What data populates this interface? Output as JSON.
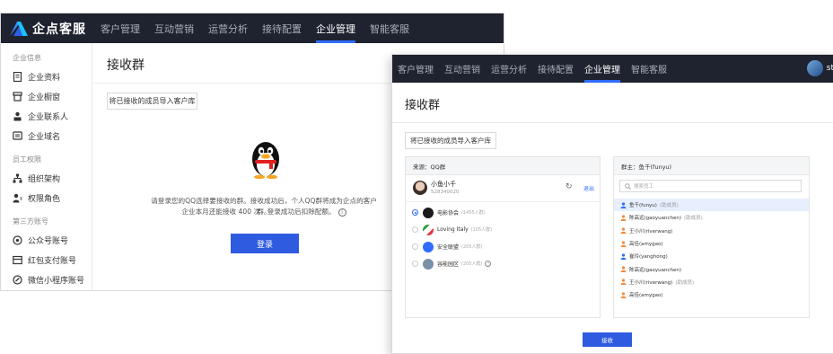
{
  "brand": {
    "name": "企点客服"
  },
  "nav": {
    "items": [
      "客户管理",
      "互动营销",
      "运营分析",
      "接待配置",
      "企业管理",
      "智能客服"
    ],
    "active_index": 4
  },
  "sidebar": {
    "groups": [
      {
        "title": "企业信息",
        "items": [
          {
            "label": "企业资料",
            "icon": "document-icon"
          },
          {
            "label": "企业橱窗",
            "icon": "store-icon"
          },
          {
            "label": "企业联系人",
            "icon": "contacts-icon"
          },
          {
            "label": "企业域名",
            "icon": "domain-icon"
          }
        ]
      },
      {
        "title": "员工权限",
        "items": [
          {
            "label": "组织架构",
            "icon": "org-chart-icon"
          },
          {
            "label": "权限角色",
            "icon": "role-icon"
          }
        ]
      },
      {
        "title": "第三方账号",
        "items": [
          {
            "label": "公众号账号",
            "icon": "official-account-icon"
          },
          {
            "label": "红包支付账号",
            "icon": "wallet-icon"
          },
          {
            "label": "微信小程序账号",
            "icon": "mini-program-icon"
          }
        ]
      }
    ]
  },
  "page": {
    "title": "接收群",
    "import_button": "将已接收的成员导入客户库"
  },
  "login_view": {
    "desc_line1": "请登录您的QQ选择要接收的群。接收成功后，个人QQ群将成为企点的客户群。",
    "desc_line2": "企业本月还能接收 400 次，登录成功后扣除配额。",
    "login_button": "登录"
  },
  "window2": {
    "user_name": "st",
    "source_panel": {
      "header": "来源：QQ群",
      "account_name": "小鱼小千",
      "account_id": "528340020",
      "refresh_icon": "refresh-icon",
      "logout_label": "退出",
      "groups": [
        {
          "name": "电影协会",
          "count": "(1455人群)",
          "checked": true,
          "color": "#1a1a1a"
        },
        {
          "name": "Loving Italy",
          "count": "(105人群)",
          "checked": false,
          "color": "#e03a3a"
        },
        {
          "name": "安全联盟",
          "count": "(205人群)",
          "checked": false,
          "color": "#2f6bff"
        },
        {
          "name": "容能园区",
          "count": "(205人群)",
          "checked": false,
          "color": "#7a8fa8",
          "info": true
        }
      ]
    },
    "member_panel": {
      "header": "群主：鱼千(funyu)",
      "search_placeholder": "搜索员工",
      "members": [
        {
          "name": "鱼千(funyu)",
          "tag": "(助成员)",
          "role": "owner",
          "selected": true
        },
        {
          "name": "陈高远(gaoyuanchen)",
          "tag": "(助成员)",
          "role": "member",
          "selected": false
        },
        {
          "name": "王小川(riverwang)",
          "tag": "",
          "role": "member",
          "selected": false
        },
        {
          "name": "高佳(amygao)",
          "tag": "",
          "role": "member",
          "selected": false
        },
        {
          "name": "崔玲(yanghong)",
          "tag": "",
          "role": "owner",
          "selected": false
        },
        {
          "name": "陈高远(gaoyuanchen)",
          "tag": "",
          "role": "member",
          "selected": false
        },
        {
          "name": "王小川(riverwang)",
          "tag": "(助成员)",
          "role": "member",
          "selected": false
        },
        {
          "name": "高佳(amygao)",
          "tag": "",
          "role": "member",
          "selected": false
        }
      ]
    },
    "accept_button": "接收"
  },
  "colors": {
    "topbar": "#1f2330",
    "accent": "#2f5be0",
    "owner_icon": "#2f6bff",
    "member_icon": "#f0883a"
  }
}
